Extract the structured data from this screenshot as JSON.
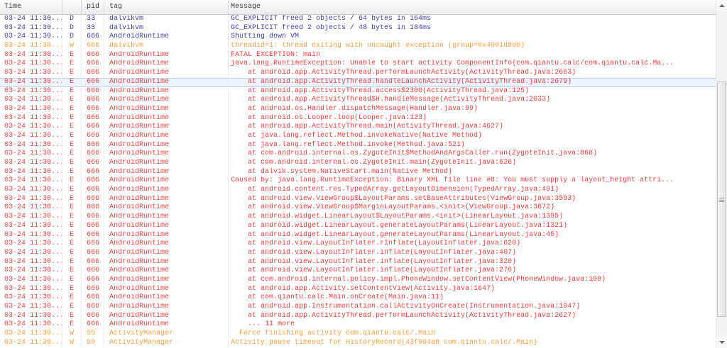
{
  "colors": {
    "debug": "#4141A8",
    "warn": "#FF9E3D",
    "error": "#F24040",
    "selection_bg": "#EDF4FD",
    "selection_border": "#BBD3F0"
  },
  "log": {
    "columns": [
      "Time",
      "",
      "pid",
      "tag",
      "Message"
    ],
    "rows": [
      {
        "time": "03-24 11:30...",
        "level": "D",
        "pid": "33",
        "tag": "dalvikvm",
        "message": "GC_EXPLICIT freed 2 objects / 64 bytes in 164ms",
        "selected": false
      },
      {
        "time": "03-24 11:30...",
        "level": "D",
        "pid": "33",
        "tag": "dalvikvm",
        "message": "GC_EXPLICIT freed 2 objects / 48 bytes in 184ms",
        "selected": false
      },
      {
        "time": "03-24 11:30...",
        "level": "D",
        "pid": "666",
        "tag": "AndroidRuntime",
        "message": "Shutting down VM",
        "selected": false
      },
      {
        "time": "03-24 11:30...",
        "level": "W",
        "pid": "666",
        "tag": "dalvikvm",
        "message": "threadid=1: thread exiting with uncaught exception (group=0x4001d800)",
        "selected": false
      },
      {
        "time": "03-24 11:30...",
        "level": "E",
        "pid": "666",
        "tag": "AndroidRuntime",
        "message": "FATAL EXCEPTION: main",
        "selected": false
      },
      {
        "time": "03-24 11:30...",
        "level": "E",
        "pid": "666",
        "tag": "AndroidRuntime",
        "message": "java.lang.RuntimeException: Unable to start activity ComponentInfo{com.qiantu.calc/com.qiantu.calc.Ma...",
        "selected": false
      },
      {
        "time": "03-24 11:30...",
        "level": "E",
        "pid": "666",
        "tag": "AndroidRuntime",
        "message": "    at android.app.ActivityThread.performLaunchActivity(ActivityThread.java:2663)",
        "selected": false
      },
      {
        "time": "03-24 11:30...",
        "level": "E",
        "pid": "666",
        "tag": "AndroidRuntime",
        "message": "    at android.app.ActivityThread.handleLaunchActivity(ActivityThread.java:2679)",
        "selected": true
      },
      {
        "time": "03-24 11:30...",
        "level": "E",
        "pid": "666",
        "tag": "AndroidRuntime",
        "message": "    at android.app.ActivityThread.access$2300(ActivityThread.java:125)",
        "selected": false
      },
      {
        "time": "03-24 11:30...",
        "level": "E",
        "pid": "666",
        "tag": "AndroidRuntime",
        "message": "    at android.app.ActivityThread$H.handleMessage(ActivityThread.java:2033)",
        "selected": false
      },
      {
        "time": "03-24 11:30...",
        "level": "E",
        "pid": "666",
        "tag": "AndroidRuntime",
        "message": "    at android.os.Handler.dispatchMessage(Handler.java:99)",
        "selected": false
      },
      {
        "time": "03-24 11:30...",
        "level": "E",
        "pid": "666",
        "tag": "AndroidRuntime",
        "message": "    at android.os.Looper.loop(Looper.java:123)",
        "selected": false
      },
      {
        "time": "03-24 11:30...",
        "level": "E",
        "pid": "666",
        "tag": "AndroidRuntime",
        "message": "    at android.app.ActivityThread.main(ActivityThread.java:4627)",
        "selected": false
      },
      {
        "time": "03-24 11:30...",
        "level": "E",
        "pid": "666",
        "tag": "AndroidRuntime",
        "message": "    at java.lang.reflect.Method.invokeNative(Native Method)",
        "selected": false
      },
      {
        "time": "03-24 11:30...",
        "level": "E",
        "pid": "666",
        "tag": "AndroidRuntime",
        "message": "    at java.lang.reflect.Method.invoke(Method.java:521)",
        "selected": false
      },
      {
        "time": "03-24 11:30...",
        "level": "E",
        "pid": "666",
        "tag": "AndroidRuntime",
        "message": "    at com.android.internal.os.ZygoteInit$MethodAndArgsCaller.run(ZygoteInit.java:868)",
        "selected": false
      },
      {
        "time": "03-24 11:30...",
        "level": "E",
        "pid": "666",
        "tag": "AndroidRuntime",
        "message": "    at com.android.internal.os.ZygoteInit.main(ZygoteInit.java:626)",
        "selected": false
      },
      {
        "time": "03-24 11:30...",
        "level": "E",
        "pid": "666",
        "tag": "AndroidRuntime",
        "message": "    at dalvik.system.NativeStart.main(Native Method)",
        "selected": false
      },
      {
        "time": "03-24 11:30...",
        "level": "E",
        "pid": "666",
        "tag": "AndroidRuntime",
        "message": "Caused by: java.lang.RuntimeException: Binary XML file line #8: You must supply a layout_height attri...",
        "selected": false
      },
      {
        "time": "03-24 11:30...",
        "level": "E",
        "pid": "666",
        "tag": "AndroidRuntime",
        "message": "    at android.content.res.TypedArray.getLayoutDimension(TypedArray.java:491)",
        "selected": false
      },
      {
        "time": "03-24 11:30...",
        "level": "E",
        "pid": "666",
        "tag": "AndroidRuntime",
        "message": "    at android.view.ViewGroup$LayoutParams.setBaseAttributes(ViewGroup.java:3593)",
        "selected": false
      },
      {
        "time": "03-24 11:30...",
        "level": "E",
        "pid": "666",
        "tag": "AndroidRuntime",
        "message": "    at android.view.ViewGroup$MarginLayoutParams.<init>(ViewGroup.java:3672)",
        "selected": false
      },
      {
        "time": "03-24 11:30...",
        "level": "E",
        "pid": "666",
        "tag": "AndroidRuntime",
        "message": "    at android.widget.LinearLayout$LayoutParams.<init>(LinearLayout.java:1395)",
        "selected": false
      },
      {
        "time": "03-24 11:30...",
        "level": "E",
        "pid": "666",
        "tag": "AndroidRuntime",
        "message": "    at android.widget.LinearLayout.generateLayoutParams(LinearLayout.java:1321)",
        "selected": false
      },
      {
        "time": "03-24 11:30...",
        "level": "E",
        "pid": "666",
        "tag": "AndroidRuntime",
        "message": "    at android.widget.LinearLayout.generateLayoutParams(LinearLayout.java:45)",
        "selected": false
      },
      {
        "time": "03-24 11:30...",
        "level": "E",
        "pid": "666",
        "tag": "AndroidRuntime",
        "message": "    at android.view.LayoutInflater.rInflate(LayoutInflater.java:620)",
        "selected": false
      },
      {
        "time": "03-24 11:30...",
        "level": "E",
        "pid": "666",
        "tag": "AndroidRuntime",
        "message": "    at android.view.LayoutInflater.inflate(LayoutInflater.java:407)",
        "selected": false
      },
      {
        "time": "03-24 11:30...",
        "level": "E",
        "pid": "666",
        "tag": "AndroidRuntime",
        "message": "    at android.view.LayoutInflater.inflate(LayoutInflater.java:320)",
        "selected": false
      },
      {
        "time": "03-24 11:30...",
        "level": "E",
        "pid": "666",
        "tag": "AndroidRuntime",
        "message": "    at android.view.LayoutInflater.inflate(LayoutInflater.java:276)",
        "selected": false
      },
      {
        "time": "03-24 11:30...",
        "level": "E",
        "pid": "666",
        "tag": "AndroidRuntime",
        "message": "    at com.android.internal.policy.impl.PhoneWindow.setContentView(PhoneWindow.java:198)",
        "selected": false
      },
      {
        "time": "03-24 11:30...",
        "level": "E",
        "pid": "666",
        "tag": "AndroidRuntime",
        "message": "    at android.app.Activity.setContentView(Activity.java:1647)",
        "selected": false
      },
      {
        "time": "03-24 11:30...",
        "level": "E",
        "pid": "666",
        "tag": "AndroidRuntime",
        "message": "    at com.qiantu.calc.Main.onCreate(Main.java:11)",
        "selected": false
      },
      {
        "time": "03-24 11:30...",
        "level": "E",
        "pid": "666",
        "tag": "AndroidRuntime",
        "message": "    at android.app.Instrumentation.callActivityOnCreate(Instrumentation.java:1047)",
        "selected": false
      },
      {
        "time": "03-24 11:30...",
        "level": "E",
        "pid": "666",
        "tag": "AndroidRuntime",
        "message": "    at android.app.ActivityThread.performLaunchActivity(ActivityThread.java:2627)",
        "selected": false
      },
      {
        "time": "03-24 11:30...",
        "level": "E",
        "pid": "666",
        "tag": "AndroidRuntime",
        "message": "    ... 11 more",
        "selected": false
      },
      {
        "time": "03-24 11:30...",
        "level": "W",
        "pid": "59",
        "tag": "ActivityManager",
        "message": "  Force finishing activity com.qiantu.calc/.Main",
        "selected": false
      },
      {
        "time": "03-24 11:30...",
        "level": "W",
        "pid": "59",
        "tag": "ActivityManager",
        "message": "Activity pause timeout for HistoryRecord{43f904a8 com.qiantu.calc/.Main}",
        "selected": false
      }
    ]
  }
}
